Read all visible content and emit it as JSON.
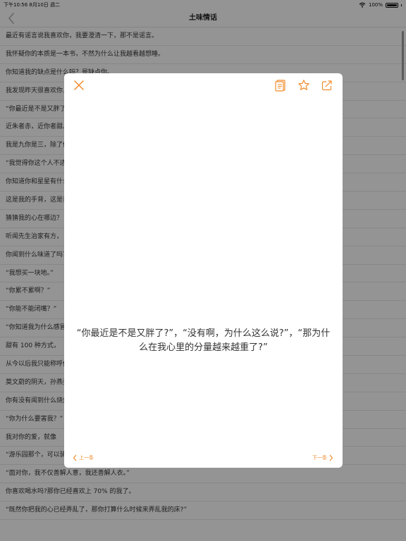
{
  "status": {
    "time": "下午10:56",
    "date": "8月10日 週二",
    "battery": "100%"
  },
  "nav": {
    "title": "土味情话"
  },
  "list": {
    "items": [
      "最近有谣言说我喜欢你，我要澄清一下，那不是谣言。",
      "我怀疑你的本质是一本书，不然为什么让我越看越想睡。",
      "你知道我的缺点是什么吗？是缺点你。",
      "我发现昨天很喜欢你，今天也很喜欢你。",
      "“你最近是不是又胖了？”",
      "近朱者赤，近你者甜。",
      "我是九你是三，除了你还是你。",
      "“我觉得你这个人不适合谈恋爱”",
      "你知道你和星星有什么区别吗？",
      "这是我的手背，这是我的脚背，你是我的宝贝。",
      "猜猜我的心在哪边？",
      "听闻先生治家有方，",
      "你闻到什么味道了吗？",
      "“我想买一块地。”",
      "“你累不累啊？”",
      "“你能不能闭嘴？”",
      "“你知道我为什么感冒了吗？”",
      "甜有 100 种方式，",
      "从今以后我只能称呼你为您了，",
      "莫文蔚的阴天，孙燕姿的雨天，",
      "你有没有闻到什么烧焦的味道？",
      "“你为什么要害我？”",
      "我对你的爱，就像",
      "“游乐园那个，可以骑在上面的”，“有音乐的叫旋转什么？”，“木马。”，“mua”",
      "“面对你，我不仅善解人意，我还善解人衣。”",
      "你喜欢喝水吗?那你已经喜欢上 70% 的我了。",
      "“既然你把我的心已经弄乱了，那你打算什么时候来弄乱我的床?”"
    ]
  },
  "modal": {
    "quote": "“你最近是不是又胖了?”，“没有啊，为什么这么说?”，“那为什么在我心里的分量越来越重了?”",
    "prev_label": "上一条",
    "next_label": "下一条"
  },
  "colors": {
    "accent": "#f28c2d",
    "overlay": "rgba(0,0,0,0.4)"
  },
  "icons": {
    "close": "close-icon",
    "notes": "notes-icon",
    "favorite": "star-icon",
    "share": "share-icon",
    "back": "chevron-left-icon",
    "wifi": "wifi-icon",
    "battery": "battery-icon"
  }
}
